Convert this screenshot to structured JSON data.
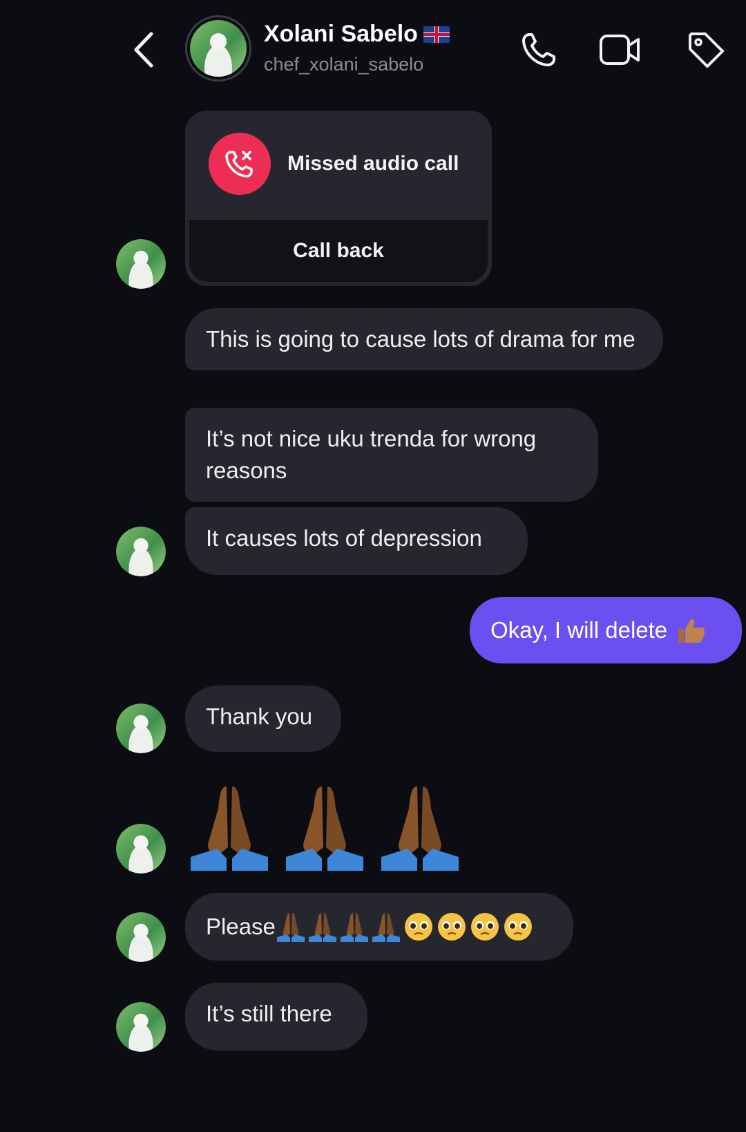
{
  "header": {
    "name": "Xolani Sabelo",
    "flag_icon": "uk-flag-icon",
    "username": "chef_xolani_sabelo",
    "icons": [
      "back-chevron-icon",
      "phone-icon",
      "video-camera-icon",
      "tag-icon"
    ]
  },
  "call_card": {
    "label": "Missed audio call",
    "action": "Call back",
    "icon": "missed-call-icon",
    "accent": "#ee2d55"
  },
  "messages": [
    {
      "direction": "incoming",
      "text": "This is going to cause lots of drama for me"
    },
    {
      "direction": "incoming",
      "text": "It’s not nice uku trenda for wrong reasons"
    },
    {
      "direction": "incoming",
      "text": "It causes lots of depression"
    },
    {
      "direction": "outgoing",
      "text": "Okay, I will delete",
      "emoji": "thumbs-up-icon"
    },
    {
      "direction": "incoming",
      "text": "Thank you"
    },
    {
      "direction": "incoming",
      "emoji_only": [
        "folded-hands-icon",
        "folded-hands-icon",
        "folded-hands-icon"
      ]
    },
    {
      "direction": "incoming",
      "text": "Please",
      "emojis": [
        "folded-hands-icon",
        "folded-hands-icon",
        "folded-hands-icon",
        "folded-hands-icon",
        "pleading-face-icon",
        "pleading-face-icon",
        "pleading-face-icon",
        "pleading-face-icon"
      ]
    },
    {
      "direction": "incoming",
      "text": "It’s still there"
    }
  ],
  "colors": {
    "background": "#0c0d12",
    "incoming_bubble": "#26272e",
    "outgoing_bubble": "#6c4ff0",
    "secondary_text": "#8a8d95"
  }
}
